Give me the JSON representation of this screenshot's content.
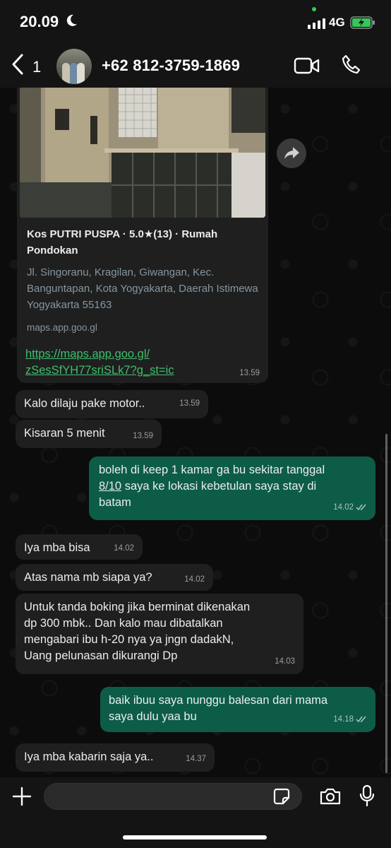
{
  "status_bar": {
    "time": "20.09",
    "network": "4G"
  },
  "header": {
    "back_count": "1",
    "contact": "+62 812-3759-1869"
  },
  "link_preview": {
    "title": "Kos PUTRI PUSPA · 5.0★(13) · Rumah Pondokan",
    "description": "Jl. Singoranu, Kragilan, Giwangan, Kec. Banguntapan, Kota Yogyakarta, Daerah Istimewa Yogyakarta 55163",
    "domain": "maps.app.goo.gl",
    "url_line1": "https://maps.app.goo.gl/",
    "url_line2": "zSesSfYH77sriSLk7?g_st=ic",
    "time": "13.59"
  },
  "messages": [
    {
      "text": "Kalo dilaju pake motor..",
      "time": "13.59"
    },
    {
      "text": "Kisaran 5 menit",
      "time": "13.59"
    },
    {
      "line1": "boleh di keep 1 kamar ga bu sekitar tanggal",
      "date": "8/10",
      "line2_rest": " saya ke lokasi kebetulan saya stay di",
      "line3": "batam",
      "time": "14.02"
    },
    {
      "text": "Iya mba bisa",
      "time": "14.02"
    },
    {
      "text": "Atas nama mb siapa ya?",
      "time": "14.02"
    },
    {
      "line1": "Untuk tanda boking jika berminat dikenakan",
      "line2": "dp 300 mbk.. Dan kalo mau dibatalkan",
      "line3": "mengabari ibu h-20 nya ya jngn dadakN,",
      "line4": "Uang pelunasan dikurangi Dp",
      "time": "14.03"
    },
    {
      "line1": "baik ibuu saya nunggu balesan dari mama",
      "line2": "saya dulu yaa bu",
      "time": "14.18"
    },
    {
      "text": "Iya mba kabarin saja ya..",
      "time": "14.37"
    }
  ],
  "composer": {
    "value": ""
  },
  "colors": {
    "outgoing": "#0d5c48",
    "incoming": "#1f1f1f",
    "link": "#3fbf6f"
  }
}
